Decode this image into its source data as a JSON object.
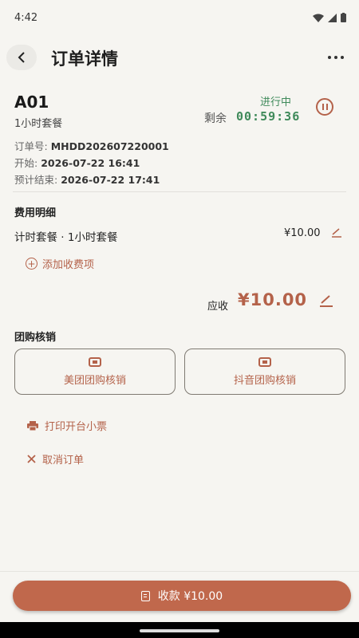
{
  "status_bar": {
    "time": "4:42"
  },
  "header": {
    "title": "订单详情"
  },
  "order": {
    "table_id": "A01",
    "package": "1小时套餐",
    "status": "进行中",
    "remaining_label": "剩余",
    "remaining_time": "00:59:36",
    "order_no_label": "订单号:",
    "order_no": "MHDD202607220001",
    "start_label": "开始:",
    "start_time": "2026-07-22 16:41",
    "end_label": "预计结束:",
    "end_time": "2026-07-22 17:41"
  },
  "fees": {
    "title": "费用明细",
    "items": [
      {
        "name": "计时套餐 · 1小时套餐",
        "price": "¥10.00"
      }
    ],
    "add_label": "添加收费项",
    "due_label": "应收",
    "due_amount": "¥10.00"
  },
  "voucher": {
    "title": "团购核销",
    "meituan_label": "美团团购核销",
    "douyin_label": "抖音团购核销"
  },
  "actions": {
    "print_label": "打印开台小票",
    "cancel_label": "取消订单"
  },
  "footer": {
    "pay_label": "收款 ¥10.00"
  },
  "colors": {
    "accent": "#b4624a",
    "pay_button": "#c0684c",
    "active_green": "#3f8a5a"
  }
}
